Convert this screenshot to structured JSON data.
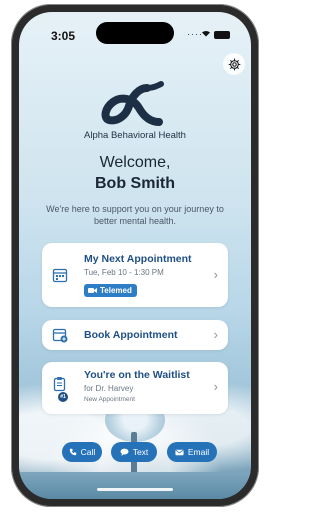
{
  "status": {
    "time": "3:05"
  },
  "brand": {
    "name": "Alpha Behavioral Health",
    "logo_icon": "alpha-logo-icon"
  },
  "welcome": {
    "greeting": "Welcome,",
    "user_name": "Bob Smith",
    "message": "We're here to support you on your journey to better mental health."
  },
  "cards": {
    "next_appointment": {
      "title": "My Next Appointment",
      "datetime": "Tue, Feb 10 - 1:30 PM",
      "badge": "Telemed"
    },
    "book": {
      "title": "Book Appointment"
    },
    "waitlist": {
      "title": "You're on the Waitlist",
      "provider": "for Dr. Harvey",
      "type": "New Appointment",
      "position": "#1"
    }
  },
  "actions": {
    "call": "Call",
    "text": "Text",
    "email": "Email"
  },
  "colors": {
    "accent": "#2672b9",
    "title_blue": "#1f4f85"
  }
}
